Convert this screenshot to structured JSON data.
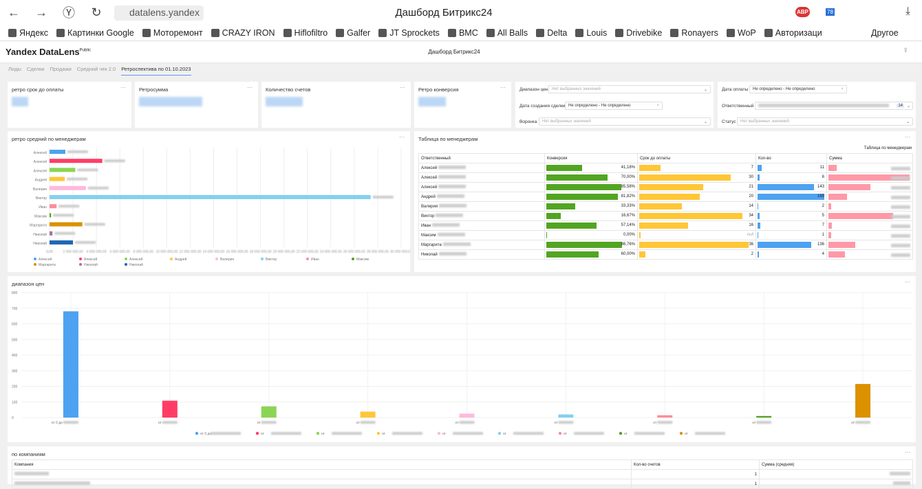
{
  "browser": {
    "url": "datalens.yandex",
    "title": "Дашборд Битрикс24",
    "bookmarks": [
      "Яндекс",
      "Картинки Google",
      "Моторемонт",
      "CRAZY IRON",
      "Hiflofiltro",
      "Galfer",
      "JT Sprockets",
      "BMC",
      "All Balls",
      "Delta",
      "Louis",
      "Drivebike",
      "Ronayers",
      "WoP",
      "Авторизаци"
    ],
    "other": "Другое",
    "abp": "ABP",
    "badge": "78"
  },
  "app": {
    "logo": "Yandex DataLens",
    "logo_sup": "Public",
    "dash_title": "Дашборд Битрикс24"
  },
  "tabs": [
    "Лиды",
    "Сделки",
    "Продажи",
    "Средний чек 2.0",
    "Ретроспектива по 01.10.2023"
  ],
  "active_tab": 4,
  "kpis": [
    "ретро срок до оплаты",
    "Ретросумма",
    "Количество счетов",
    "Ретро конверсия"
  ],
  "filters": {
    "price_range": {
      "label": "Диапазон цен",
      "placeholder": "Нет выбранных значений"
    },
    "deal_date": {
      "label": "Дата создания сделки",
      "value": "Не определено - Не определено"
    },
    "funnel": {
      "label": "Воронка",
      "placeholder": "Нет выбранных значений"
    },
    "pay_date": {
      "label": "Дата оплаты",
      "value": "Не определено - Не определено"
    },
    "responsible": {
      "label": "Ответственный",
      "count": "14"
    },
    "status": {
      "label": "Статус",
      "placeholder": "Нет выбранных значений"
    }
  },
  "managers_table": {
    "title": "Таблица по менеджерам",
    "subtitle": "Таблица по менеджерам",
    "headers": [
      "Ответственный",
      "Конверсия",
      "Срок до оплаты",
      "Кол-во",
      "Сумма"
    ],
    "rows": [
      {
        "name": "Алексей",
        "conv": "41,18%",
        "conv_v": 41.18,
        "days": "7",
        "days_v": 7,
        "cnt": "11",
        "cnt_v": 11,
        "sum_frac": 0.1
      },
      {
        "name": "Алексей",
        "conv": "70,00%",
        "conv_v": 70,
        "days": "30",
        "days_v": 30,
        "cnt": "6",
        "cnt_v": 6,
        "sum_frac": 1.0
      },
      {
        "name": "Алексей",
        "conv": "85,58%",
        "conv_v": 85.58,
        "days": "21",
        "days_v": 21,
        "cnt": "143",
        "cnt_v": 143,
        "sum_frac": 0.52
      },
      {
        "name": "Андрей",
        "conv": "81,82%",
        "conv_v": 81.82,
        "days": "20",
        "days_v": 20,
        "cnt": "169",
        "cnt_v": 169,
        "sum_frac": 0.23
      },
      {
        "name": "Валерия",
        "conv": "33,33%",
        "conv_v": 33.33,
        "days": "14",
        "days_v": 14,
        "cnt": "2",
        "cnt_v": 2,
        "sum_frac": 0.03
      },
      {
        "name": "Виктор",
        "conv": "16,67%",
        "conv_v": 16.67,
        "days": "34",
        "days_v": 34,
        "cnt": "5",
        "cnt_v": 5,
        "sum_frac": 0.8
      },
      {
        "name": "Иван",
        "conv": "57,14%",
        "conv_v": 57.14,
        "days": "16",
        "days_v": 16,
        "cnt": "7",
        "cnt_v": 7,
        "sum_frac": 0.04
      },
      {
        "name": "Максим",
        "conv": "0,00%",
        "conv_v": 0,
        "days": "null",
        "days_v": 0,
        "cnt": "1",
        "cnt_v": 1,
        "sum_frac": 0.03
      },
      {
        "name": "Маргарита",
        "conv": "86,76%",
        "conv_v": 86.76,
        "days": "36",
        "days_v": 36,
        "cnt": "136",
        "cnt_v": 136,
        "sum_frac": 0.33
      },
      {
        "name": "Николай",
        "conv": "60,00%",
        "conv_v": 60,
        "days": "2",
        "days_v": 2,
        "cnt": "4",
        "cnt_v": 4,
        "sum_frac": 0.2
      }
    ]
  },
  "chart_data": [
    {
      "type": "bar",
      "orientation": "horizontal",
      "title": "ретро средний по менеджерам",
      "xlim": [
        0,
        30000000
      ],
      "grid": true,
      "legend": "bottom",
      "categories": [
        "Алексей",
        "Алексей",
        "Алексей",
        "Андрей",
        "Валерия",
        "Виктор",
        "Иван",
        "Максим",
        "Маргарита",
        "Николай",
        "Николай"
      ],
      "values": [
        1350000,
        4500000,
        2200000,
        1300000,
        3100000,
        27400000,
        600000,
        130000,
        2800000,
        250000,
        2000000
      ],
      "colors": [
        "#4da2f1",
        "#ff3d64",
        "#8ad554",
        "#ffc636",
        "#ffb9dd",
        "#84d0f0",
        "#fd8d9b",
        "#4fa21f",
        "#db9100",
        "#a5719f",
        "#1f68b3"
      ]
    },
    {
      "type": "bar",
      "title": "диапазон цен",
      "ylim": [
        0,
        800
      ],
      "yticks": [
        0,
        100,
        200,
        300,
        400,
        500,
        600,
        700,
        800
      ],
      "grid": true,
      "legend": "bottom",
      "values": [
        680,
        108,
        72,
        38,
        25,
        20,
        15,
        10,
        215
      ],
      "colors": [
        "#4da2f1",
        "#ff3d64",
        "#8ad554",
        "#ffc636",
        "#ffb9dd",
        "#84d0f0",
        "#fd8d9b",
        "#4fa21f",
        "#db9100"
      ],
      "categories": [
        "от 0 до",
        "от",
        "от",
        "от",
        "от",
        "от",
        "от",
        "от",
        "от"
      ]
    }
  ],
  "companies": {
    "title": "по компаниям",
    "headers": [
      "Компания",
      "Кол-во счетов",
      "Сумма (средняя)"
    ],
    "rows": [
      {
        "cnt": "1"
      },
      {
        "cnt": "1"
      }
    ]
  }
}
